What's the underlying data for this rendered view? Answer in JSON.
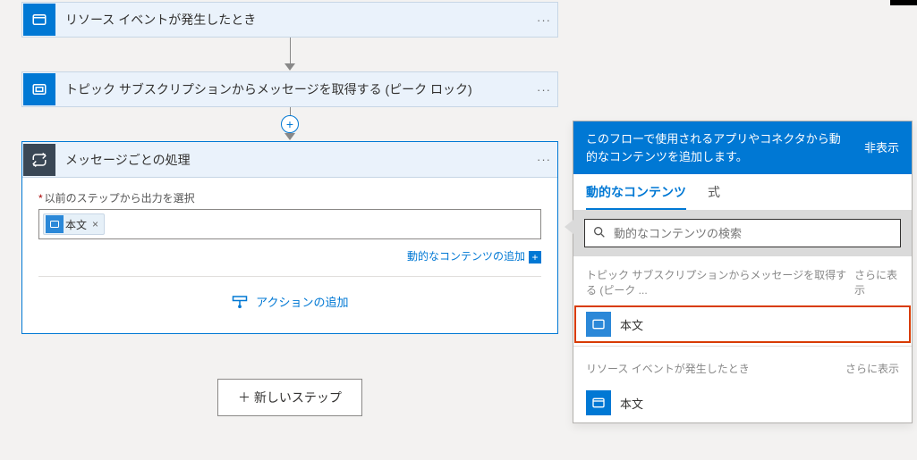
{
  "workflow": {
    "trigger": {
      "title": "リソース イベントが発生したとき"
    },
    "action1": {
      "title": "トピック サブスクリプションからメッセージを取得する (ピーク ロック)"
    },
    "forEach": {
      "title": "メッセージごとの処理",
      "fieldLabel": "以前のステップから出力を選択",
      "chipLabel": "本文",
      "addDynamic": "動的なコンテンツの追加",
      "addAction": "アクションの追加"
    },
    "newStep": "＋ 新しいステップ"
  },
  "panel": {
    "headerText": "このフローで使用されるアプリやコネクタから動的なコンテンツを追加します。",
    "hide": "非表示",
    "tabs": {
      "dynamic": "動的なコンテンツ",
      "expression": "式"
    },
    "searchPlaceholder": "動的なコンテンツの検索",
    "sections": [
      {
        "title": "トピック サブスクリプションからメッセージを取得する (ピーク ...",
        "more": "さらに表示",
        "item": "本文",
        "iconStyle": "light",
        "highlight": true
      },
      {
        "title": "リソース イベントが発生したとき",
        "more": "さらに表示",
        "item": "本文",
        "iconStyle": "dark",
        "highlight": false
      }
    ]
  }
}
